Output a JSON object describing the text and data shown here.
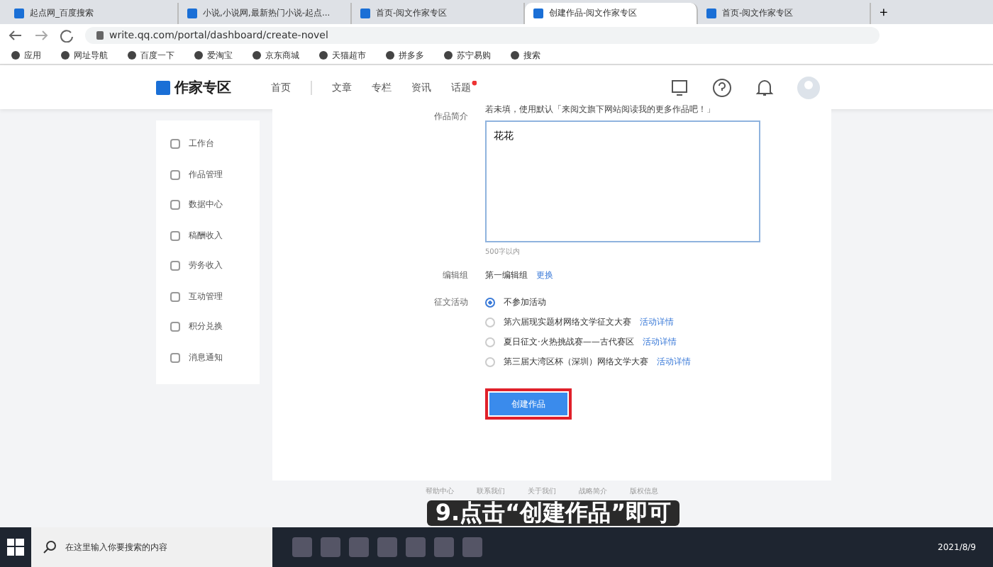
{
  "browser": {
    "tabs": [
      {
        "title": "起点网_百度搜索",
        "selected": false
      },
      {
        "title": "小说,小说网,最新热门小说-起点...",
        "selected": false
      },
      {
        "title": "首页-阅文作家专区",
        "selected": false
      },
      {
        "title": "创建作品-阅文作家专区",
        "selected": true
      },
      {
        "title": "首页-阅文作家专区",
        "selected": false
      }
    ],
    "new_tab": "+",
    "url": "write.qq.com/portal/dashboard/create-novel",
    "bookmarks": [
      "应用",
      "网址导航",
      "百度一下",
      "爱淘宝",
      "京东商城",
      "天猫超市",
      "拼多多",
      "苏宁易购",
      "搜索"
    ]
  },
  "header": {
    "logo": "作家专区",
    "nav": [
      {
        "label": "首页",
        "badge": false
      },
      {
        "label": "文章",
        "badge": false
      },
      {
        "label": "专栏",
        "badge": false
      },
      {
        "label": "资讯",
        "badge": false
      },
      {
        "label": "话题",
        "badge": true
      }
    ]
  },
  "sidebar": {
    "items": [
      {
        "label": "工作台"
      },
      {
        "label": "作品管理"
      },
      {
        "label": "数据中心"
      },
      {
        "label": "稿酬收入"
      },
      {
        "label": "劳务收入"
      },
      {
        "label": "互动管理"
      },
      {
        "label": "积分兑换"
      },
      {
        "label": "消息通知"
      }
    ]
  },
  "form": {
    "intro": {
      "label": "作品简介",
      "hint": "若未填，使用默认「来阅文旗下网站阅读我的更多作品吧！」",
      "value": "花花",
      "limit": "500字以内"
    },
    "editor_group": {
      "label": "编辑组",
      "value": "第一编辑组",
      "link": "更换"
    },
    "contest": {
      "label": "征文活动",
      "options": [
        {
          "label": "不参加活动",
          "selected": true
        },
        {
          "label": "第六届现实题材网络文学征文大赛",
          "link": "活动详情",
          "selected": false
        },
        {
          "label": "夏日征文·火热挑战赛——古代赛区",
          "link": "活动详情",
          "selected": false
        },
        {
          "label": "第三届大湾区杯（深圳）网络文学大赛",
          "link": "活动详情",
          "selected": false
        }
      ]
    },
    "submit": "创建作品"
  },
  "footer": {
    "links": [
      "帮助中心",
      "联系我们",
      "关于我们",
      "战略简介",
      "版权信息"
    ]
  },
  "caption": "9.点击“创建作品”即可",
  "taskbar": {
    "search_placeholder": "在这里输入你要搜索的内容",
    "date": "2021/8/9"
  }
}
